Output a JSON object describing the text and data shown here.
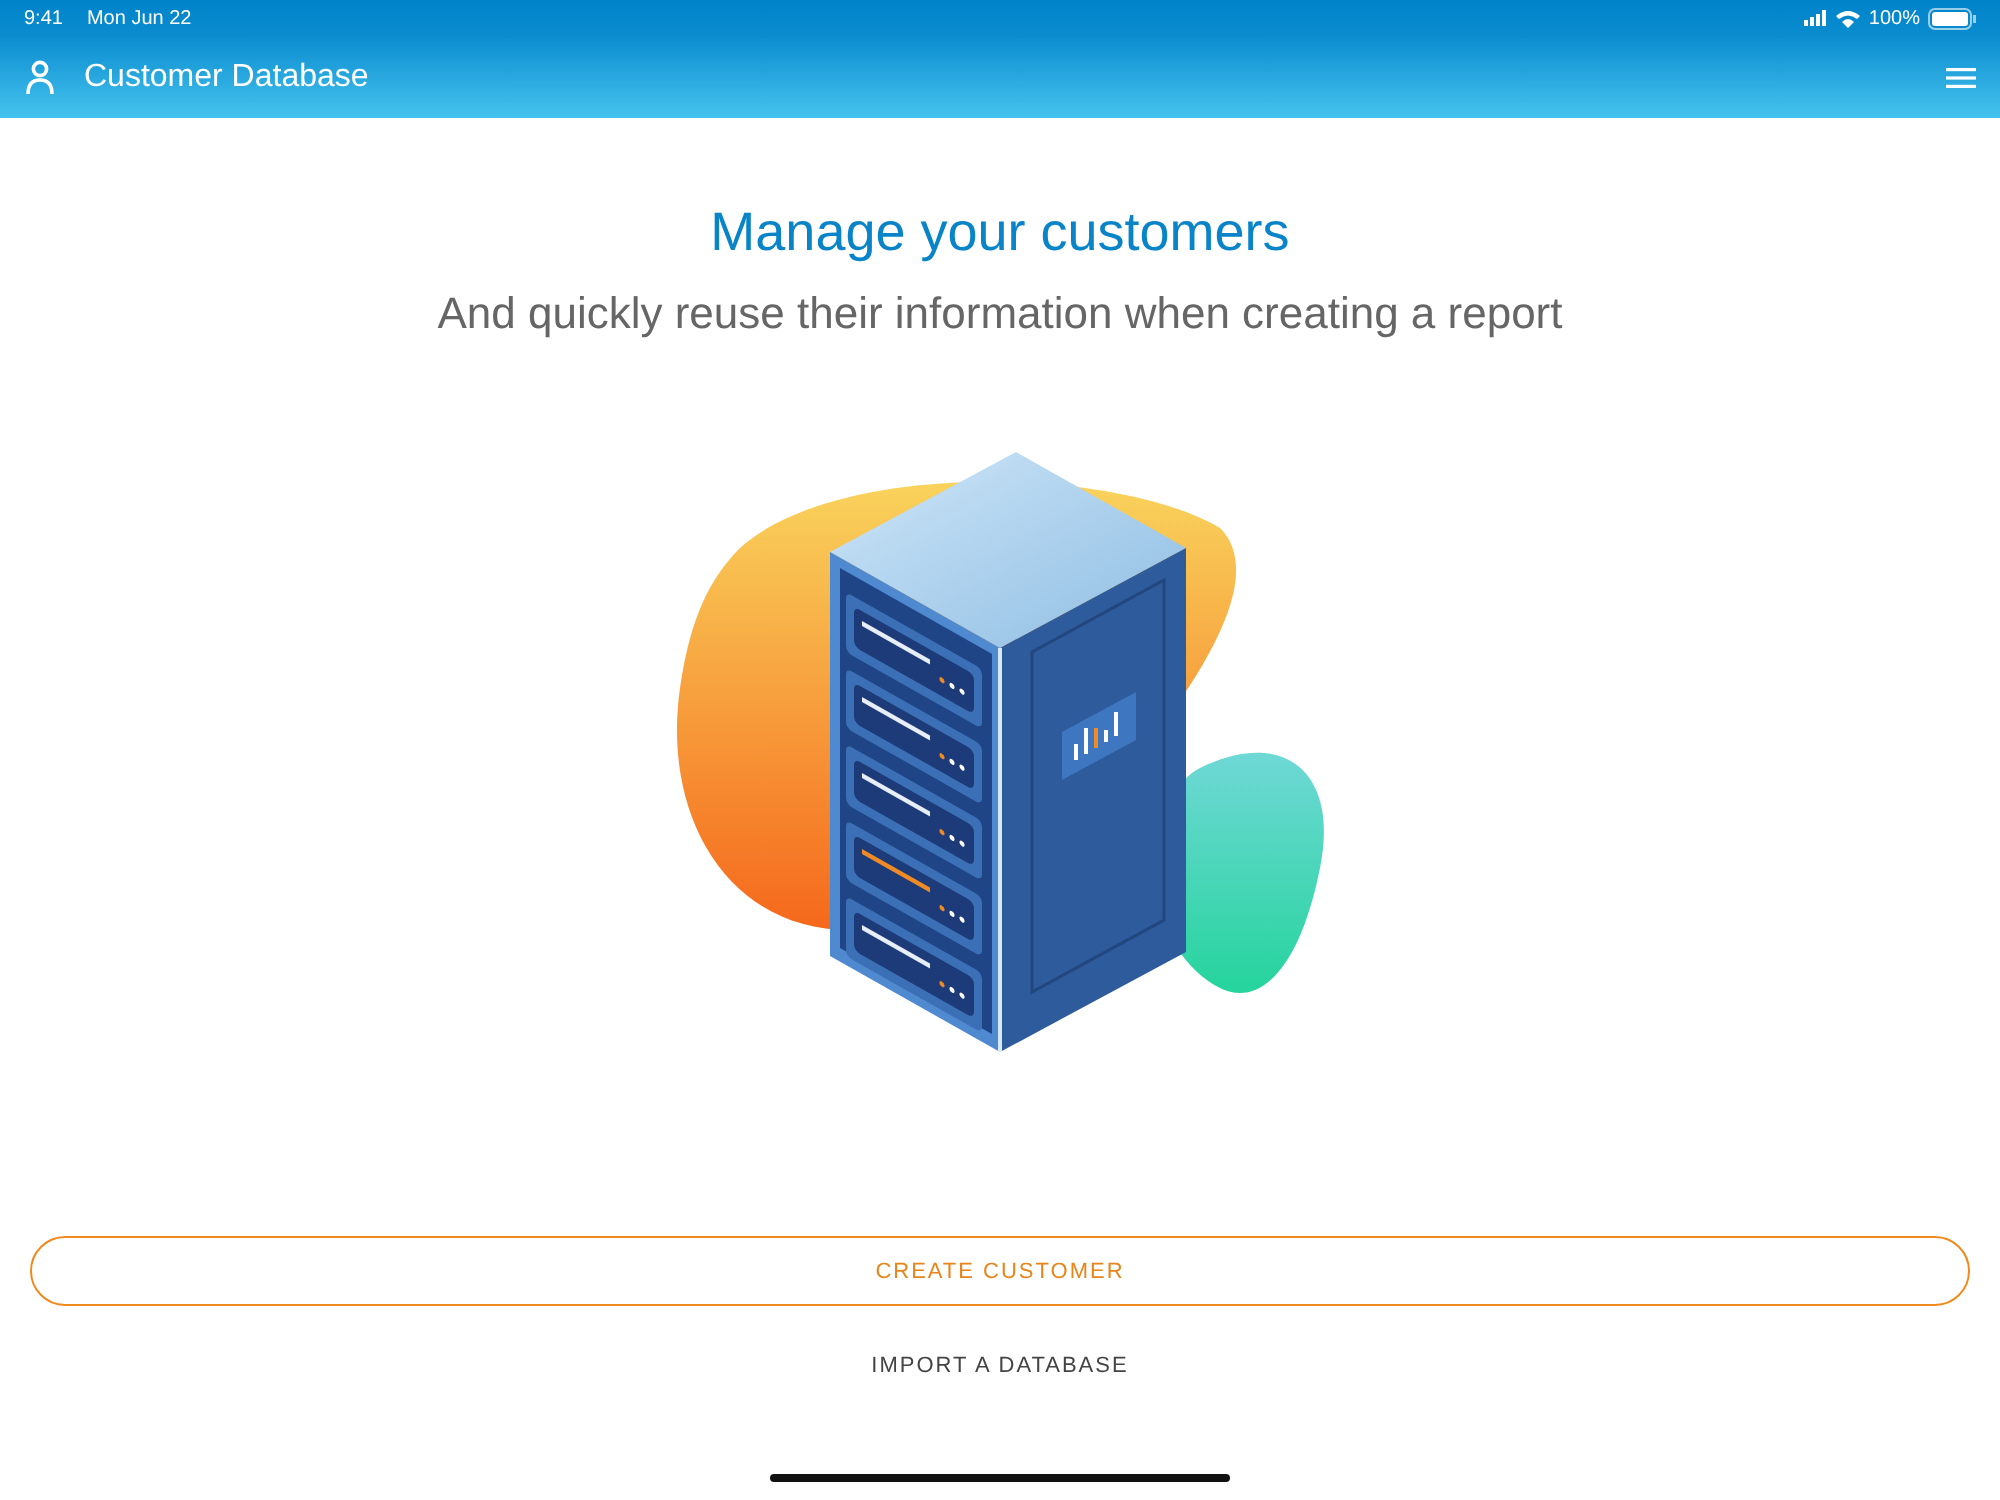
{
  "status_bar": {
    "time": "9:41",
    "date": "Mon Jun 22",
    "battery": "100%"
  },
  "header": {
    "title": "Customer Database"
  },
  "hero": {
    "title": "Manage your customers",
    "subtitle": "And quickly reuse their information when creating a report"
  },
  "drive_bays": [
    {
      "highlighted": false
    },
    {
      "highlighted": false
    },
    {
      "highlighted": false
    },
    {
      "highlighted": true
    },
    {
      "highlighted": false
    }
  ],
  "actions": [
    {
      "label": "CREATE CUSTOMER",
      "kind": "outlined"
    },
    {
      "label": "IMPORT A DATABASE",
      "kind": "text"
    }
  ]
}
